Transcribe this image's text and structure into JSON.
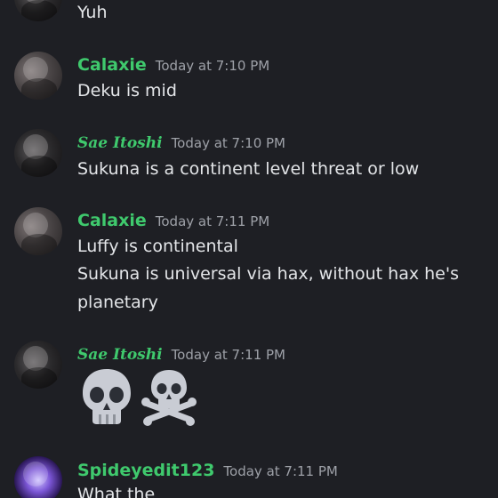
{
  "messages": [
    {
      "id": "m0",
      "text_lines": [
        "Yuh"
      ]
    },
    {
      "id": "m1",
      "author": "Calaxie",
      "time": "Today at 7:10 PM",
      "text_lines": [
        "Deku is mid"
      ],
      "avatar": "calaxie-avatar"
    },
    {
      "id": "m2",
      "author": "Sae Itoshi",
      "time": "Today at 7:10 PM",
      "text_lines": [
        "Sukuna is a continent level threat or low"
      ],
      "avatar": "sae-avatar"
    },
    {
      "id": "m3",
      "author": "Calaxie",
      "time": "Today at 7:11 PM",
      "text_lines": [
        "Luffy is continental",
        "Sukuna is universal via hax, without hax he's",
        "planetary"
      ],
      "avatar": "calaxie-avatar"
    },
    {
      "id": "m4",
      "author": "Sae Itoshi",
      "time": "Today at 7:11 PM",
      "emoji": [
        "skull-emoji",
        "skull-and-crossbones-emoji"
      ],
      "avatar": "sae-avatar"
    },
    {
      "id": "m5",
      "author": "Spideyedit123",
      "time": "Today at 7:11 PM",
      "text_lines": [
        "What the"
      ],
      "avatar": "spidey-avatar"
    }
  ],
  "colors": {
    "background": "#1e1f24",
    "username": "#3fc96d",
    "timestamp": "#9ea1a8",
    "text": "#e3e5e8"
  }
}
